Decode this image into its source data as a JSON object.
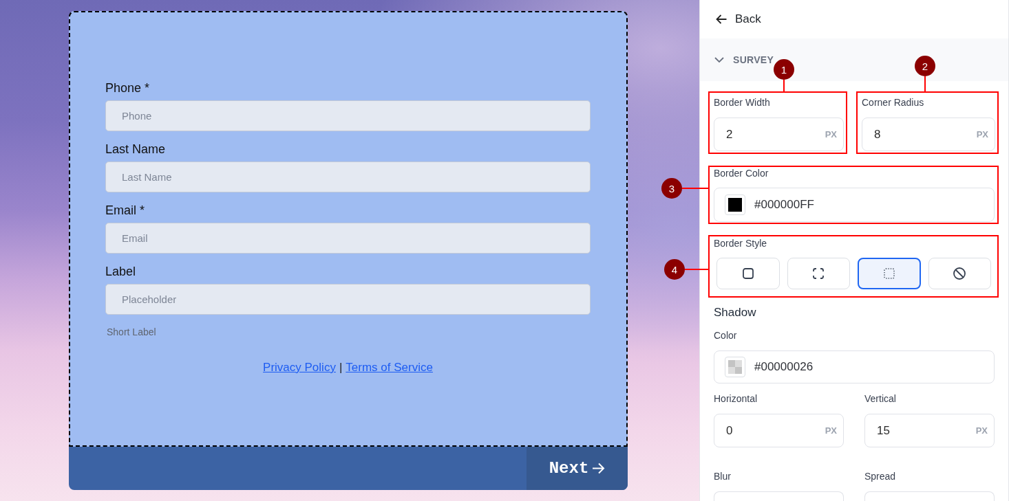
{
  "form": {
    "fields": [
      {
        "label": "Phone *",
        "placeholder": "Phone"
      },
      {
        "label": "Last Name",
        "placeholder": "Last Name"
      },
      {
        "label": "Email *",
        "placeholder": "Email"
      },
      {
        "label": "Label",
        "placeholder": "Placeholder",
        "help_text": "Short Label"
      }
    ],
    "links": [
      "Privacy Policy",
      "Terms of Service"
    ],
    "link_separator": "|",
    "next_button": "Next"
  },
  "panel": {
    "back": "Back",
    "section": {
      "title": "SURVEY",
      "expanded": true
    },
    "border_size": [
      {
        "label": "Border Width",
        "value": "2",
        "unit": "PX",
        "callout": "1"
      },
      {
        "label": "Corner Radius",
        "value": "8",
        "unit": "PX",
        "callout": "2"
      }
    ],
    "border_color": {
      "label": "Border Color",
      "value": "#000000FF",
      "color": "#000000",
      "callout": "3"
    },
    "border_style": {
      "label": "Border Style",
      "callout": "4",
      "options": [
        {
          "kind": "solid",
          "selected": false
        },
        {
          "kind": "dashed",
          "selected": false
        },
        {
          "kind": "dotted",
          "selected": true
        },
        {
          "kind": "none",
          "selected": false
        }
      ]
    },
    "shadow": {
      "title": "Shadow",
      "color": {
        "label": "Color",
        "value": "#00000026"
      },
      "offsets": [
        {
          "label": "Horizontal",
          "value": "0",
          "unit": "PX"
        },
        {
          "label": "Vertical",
          "value": "15",
          "unit": "PX"
        }
      ],
      "size": [
        {
          "label": "Blur"
        },
        {
          "label": "Spread"
        }
      ]
    }
  }
}
